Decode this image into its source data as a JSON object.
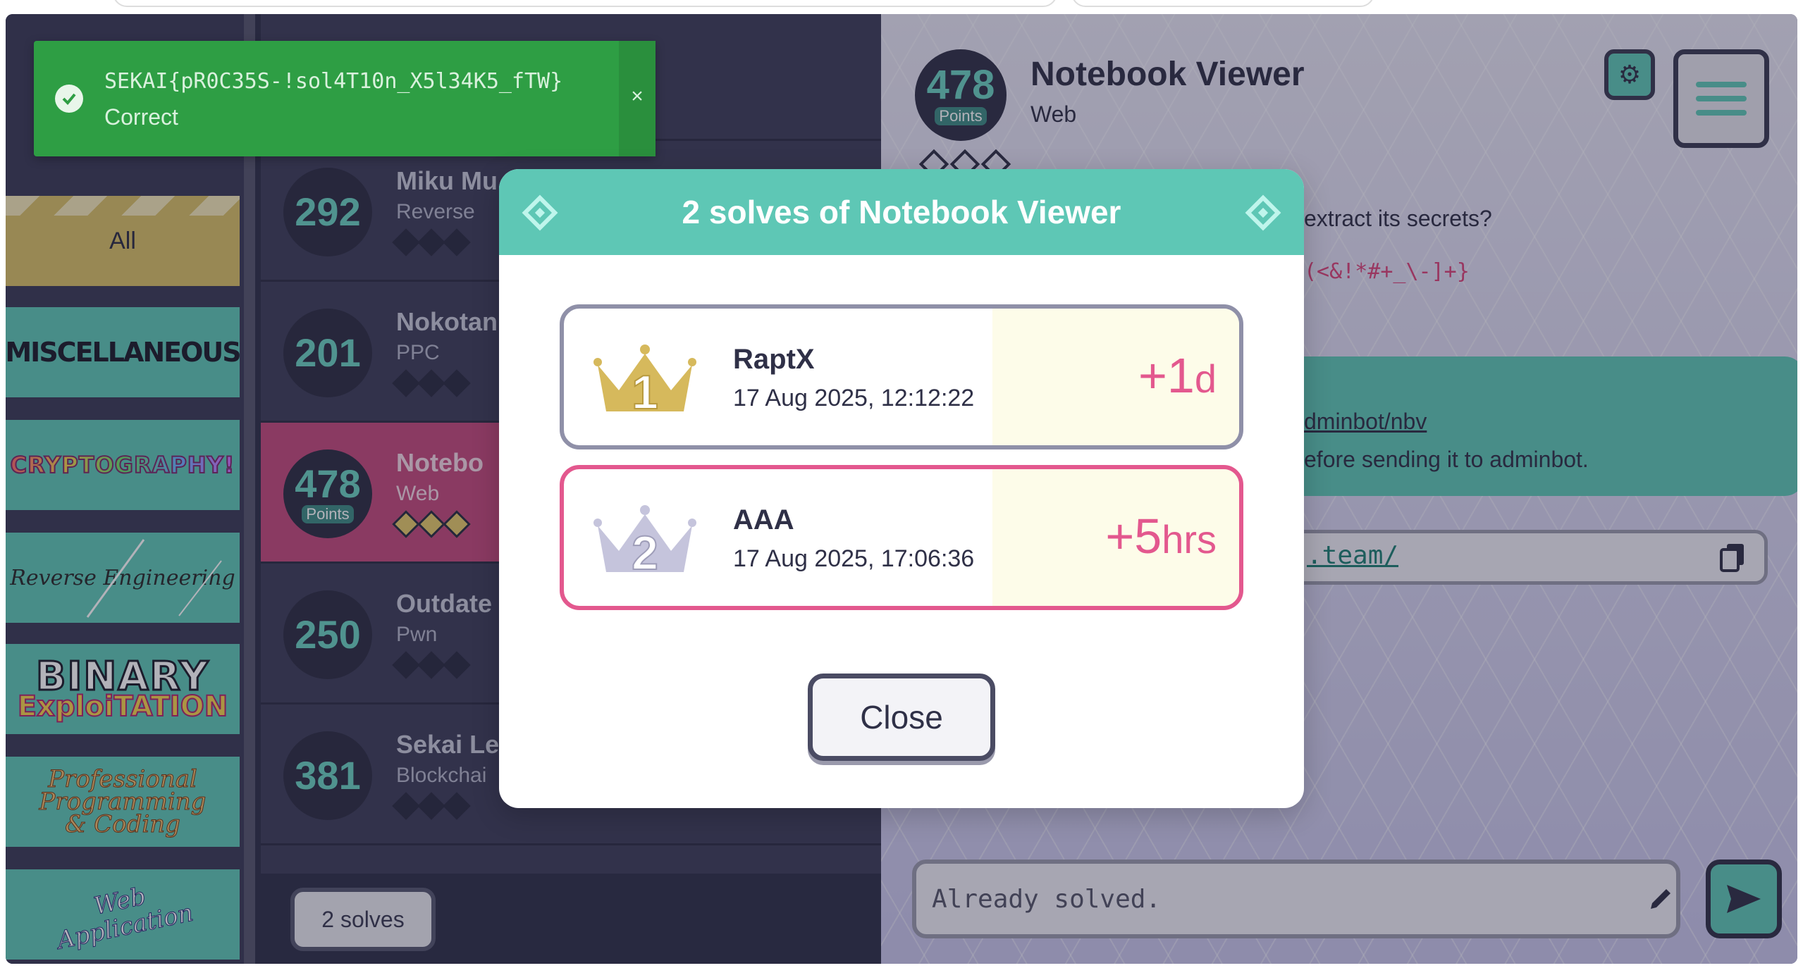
{
  "categories": [
    {
      "label": "All"
    },
    {
      "label": "MISCELLANEOUS"
    },
    {
      "label": "CRYPTOGRAPHY!"
    },
    {
      "label": "Reverse Engineering"
    },
    {
      "label_line1": "BINARY",
      "label_line2": "ExploiTATION"
    },
    {
      "label_line1": "Professional",
      "label_line2": "Programming",
      "label_line3": "& Coding"
    },
    {
      "label_line1": "Web",
      "label_line2": "Application"
    }
  ],
  "challenges": [
    {
      "points": "292",
      "name": "Miku Mu",
      "category": "Reverse"
    },
    {
      "points": "201",
      "name": "Nokotan",
      "category": "PPC"
    },
    {
      "points": "478",
      "points_label": "Points",
      "name": "Notebo",
      "category": "Web"
    },
    {
      "points": "250",
      "name": "Outdate",
      "category": "Pwn"
    },
    {
      "points": "381",
      "name": "Sekai Le",
      "category": "Blockchai"
    }
  ],
  "solves_button": "2 solves",
  "detail": {
    "points": "478",
    "points_label": "Points",
    "title": "Notebook Viewer",
    "category": "Web",
    "description_fragment": "extract its secrets?",
    "regex_fragment": "(<&!*#+_\\-]+}",
    "link_fragment": "dminbot/nbv",
    "note_fragment": "efore sending it to adminbot.",
    "url_fragment": ".team/",
    "flag_input_placeholder": "Already solved."
  },
  "toast": {
    "flag": "SEKAI{pR0C35S-!sol4T10n_X5l34K5_fTW}",
    "status": "Correct",
    "close": "×"
  },
  "modal": {
    "title": "2 solves of Notebook Viewer",
    "solves": [
      {
        "rank": "1",
        "name": "RaptX",
        "date": "17 Aug 2025, 12:12:22",
        "delta_value": "+1",
        "delta_unit": "d"
      },
      {
        "rank": "2",
        "name": "AAA",
        "date": "17 Aug 2025, 17:06:36",
        "delta_value": "+5",
        "delta_unit": "hrs"
      }
    ],
    "close_label": "Close"
  },
  "colors": {
    "teal": "#5ec7b5",
    "pink": "#e3588e",
    "gold": "#d6b95c",
    "silver": "#c5c4dc",
    "toast_green": "#2e9e44"
  },
  "icons": {
    "toast": "check-circle-icon",
    "settings": "gear-icon",
    "menu": "hamburger-menu-icon",
    "copy": "copy-icon",
    "edit": "pencil-icon",
    "send": "send-arrow-icon",
    "rank1": "gold-crown-icon",
    "rank2": "silver-crown-icon"
  }
}
